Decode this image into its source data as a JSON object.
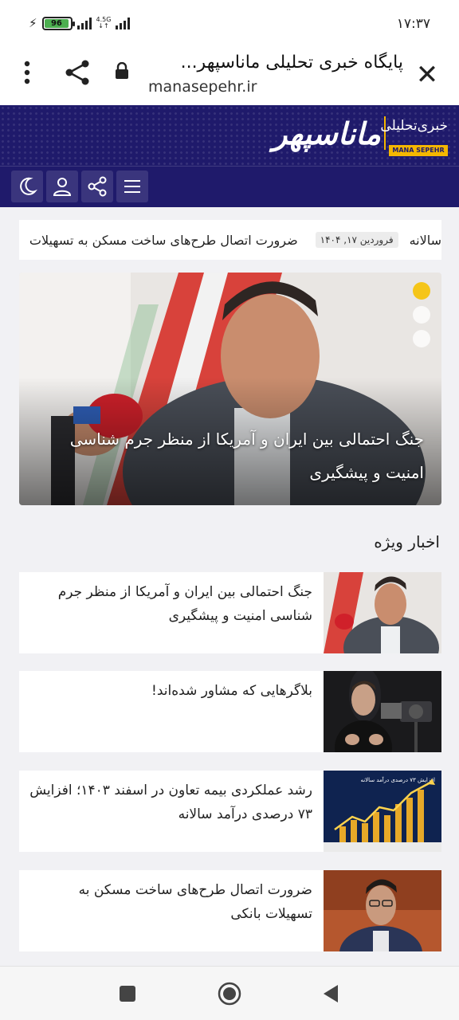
{
  "status_bar": {
    "time": "۱۷:۳۷",
    "battery": "96",
    "battery_level": 0.96,
    "network": "4.5G"
  },
  "browser": {
    "title": "پایگاه خبری تحلیلی ماناسپهر...",
    "url": "manasepehr.ir"
  },
  "site_header": {
    "logo_main": "ماناسپهر",
    "logo_sub": "خبری‌تحلیلی",
    "logo_en": "MANA SEPEHR"
  },
  "ticker": {
    "prev_text": "سالانه",
    "date": "فروردین ۱۷, ۱۴۰۴",
    "text": "ضرورت اتصال طرح‌های ساخت مسکن به تسهیلات"
  },
  "hero": {
    "title": "جنگ احتمالی بین ایران و آمریکا از منظر جرم شناسی امنیت و پیشگیری"
  },
  "section": {
    "title": "اخبار ویژه"
  },
  "news": [
    {
      "title": "جنگ احتمالی بین ایران و آمریکا از منظر جرم شناسی امنیت و پیشگیری"
    },
    {
      "title": "بلاگرهایی که مشاور شده‌اند!"
    },
    {
      "title": "رشد عملکردی بیمه تعاون در اسفند ۱۴۰۳؛ افزایش ۷۳ درصدی درآمد سالانه"
    },
    {
      "title": "ضرورت اتصال طرح‌های ساخت مسکن به تسهیلات بانکی"
    }
  ],
  "thumb_chart_text": "افزایش ۷۳ درصدی درآمد سالانه",
  "colors": {
    "header_bg": "#1f1a6b",
    "accent": "#f5b700",
    "slider_active": "#f5c518"
  }
}
